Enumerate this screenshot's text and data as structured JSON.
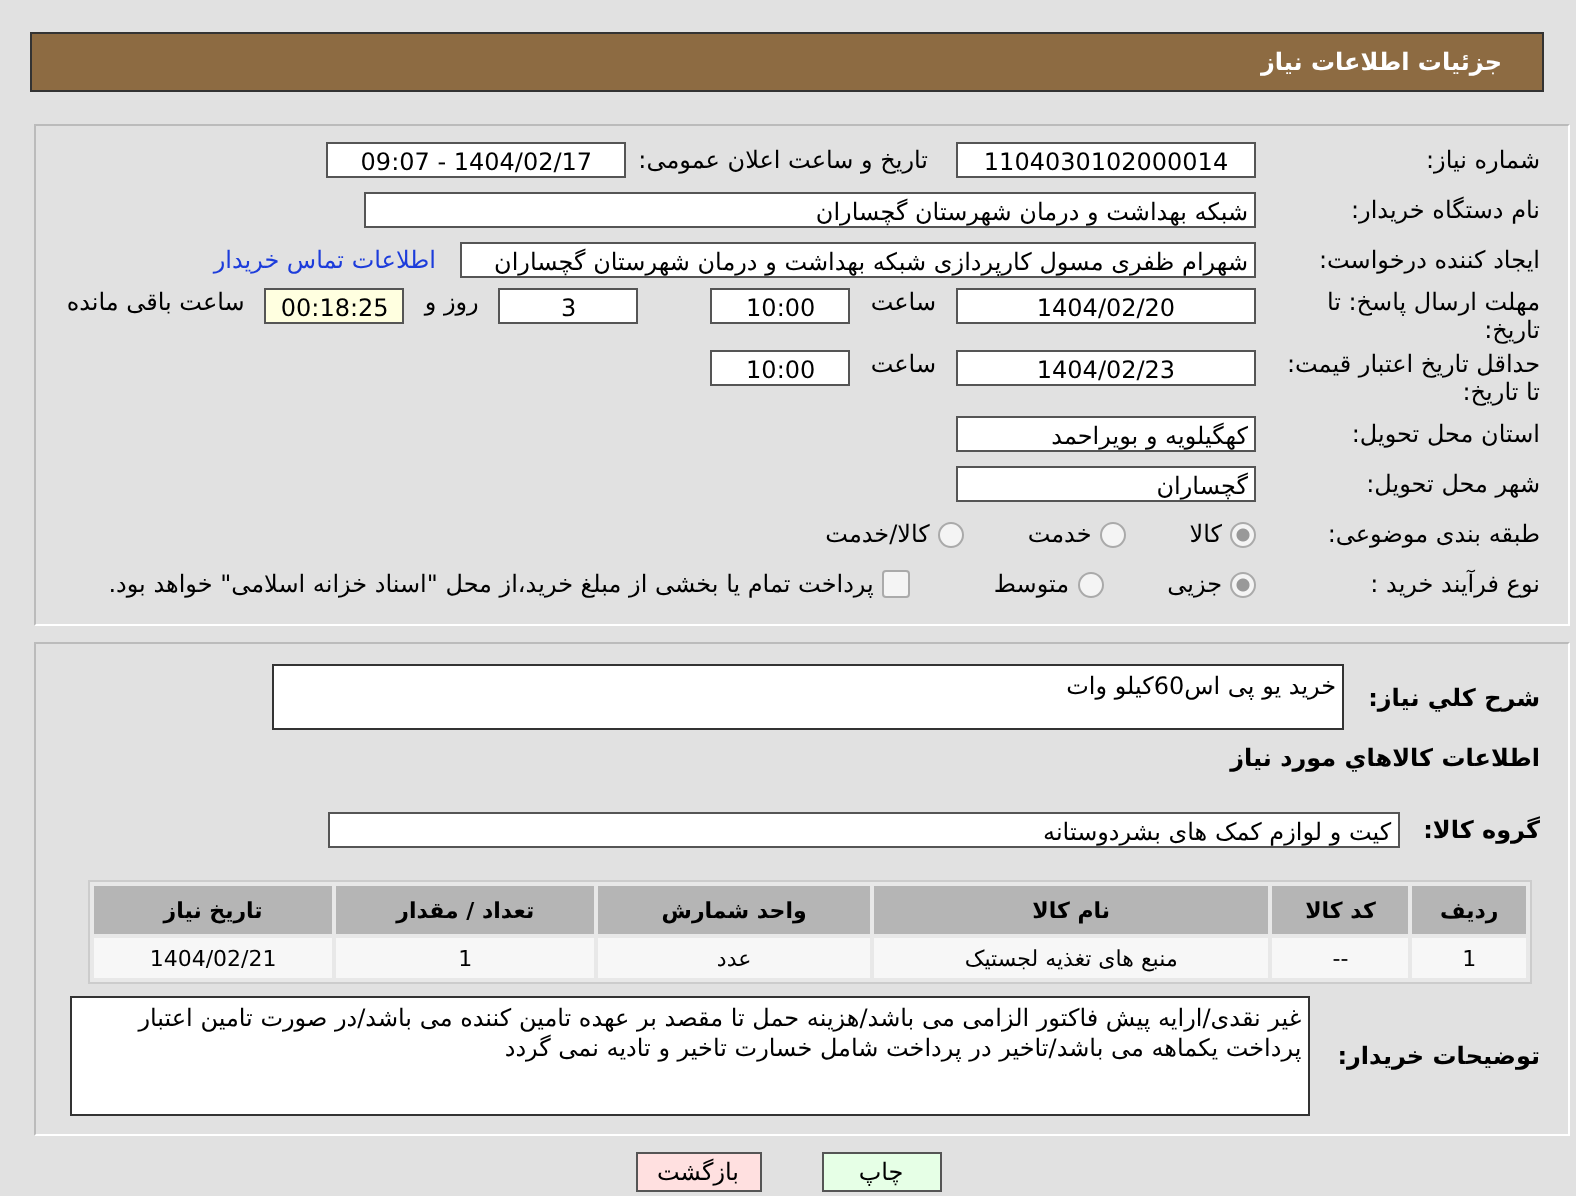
{
  "header": {
    "title": "جزئیات اطلاعات نیاز"
  },
  "need_number": {
    "label": "شماره نیاز:",
    "value": "1104030102000014"
  },
  "announce": {
    "label": "تاریخ و ساعت اعلان عمومی:",
    "value": "1404/02/17 - 09:07"
  },
  "buyer_org": {
    "label": "نام دستگاه خریدار:",
    "value": "شبکه بهداشت و درمان شهرستان گچساران"
  },
  "requester": {
    "label": "ایجاد کننده درخواست:",
    "value": "شهرام ظفری مسول کارپردازی  شبکه بهداشت و درمان شهرستان گچساران",
    "link": "اطلاعات تماس خریدار"
  },
  "deadline": {
    "label": "مهلت ارسال پاسخ: تا تاریخ:",
    "date": "1404/02/20",
    "time_label": "ساعت",
    "time": "10:00",
    "days": "3",
    "days_label": "روز و",
    "remaining": "00:18:25",
    "remaining_label": "ساعت باقی مانده"
  },
  "validity": {
    "label": "حداقل تاریخ اعتبار قیمت: تا تاریخ:",
    "date": "1404/02/23",
    "time_label": "ساعت",
    "time": "10:00"
  },
  "province": {
    "label": "استان محل تحویل:",
    "value": "کهگیلویه و بویراحمد"
  },
  "city": {
    "label": "شهر محل تحویل:",
    "value": "گچساران"
  },
  "category": {
    "label": "طبقه بندی موضوعی:",
    "options": [
      {
        "label": "کالا",
        "selected": true
      },
      {
        "label": "خدمت",
        "selected": false
      },
      {
        "label": "کالا/خدمت",
        "selected": false
      }
    ]
  },
  "purchase_type": {
    "label": "نوع فرآیند خرید :",
    "options": [
      {
        "label": "جزیی",
        "selected": true
      },
      {
        "label": "متوسط",
        "selected": false
      }
    ],
    "treasury": {
      "label": "پرداخت تمام یا بخشی از مبلغ خرید،از محل \"اسناد خزانه اسلامی\" خواهد بود.",
      "checked": false
    }
  },
  "summary": {
    "label": "شرح كلي نياز:",
    "value": "خرید یو پی اس60کیلو وات"
  },
  "goods_heading": "اطلاعات كالاهاي مورد نياز",
  "goods_group": {
    "label": "گروه کالا:",
    "value": "کیت و لوازم کمک های بشردوستانه"
  },
  "table": {
    "columns": [
      "ردیف",
      "کد کالا",
      "نام کالا",
      "واحد شمارش",
      "تعداد / مقدار",
      "تاریخ نیاز"
    ],
    "rows": [
      [
        "1",
        "--",
        "منبع های تغذیه لجستیک",
        "عدد",
        "1",
        "1404/02/21"
      ]
    ]
  },
  "buyer_notes": {
    "label": "توضیحات خریدار:",
    "value": "غیر نقدی/ارایه پیش فاکتور الزامی می باشد/هزینه حمل تا مقصد بر عهده تامین کننده می باشد/در صورت تامین اعتبار پرداخت یکماهه می باشد/تاخیر در پرداخت شامل خسارت تاخیر و تادیه نمی گردد"
  },
  "buttons": [
    {
      "label": "چاپ",
      "kind": "print"
    },
    {
      "label": "بازگشت",
      "kind": "back"
    }
  ]
}
